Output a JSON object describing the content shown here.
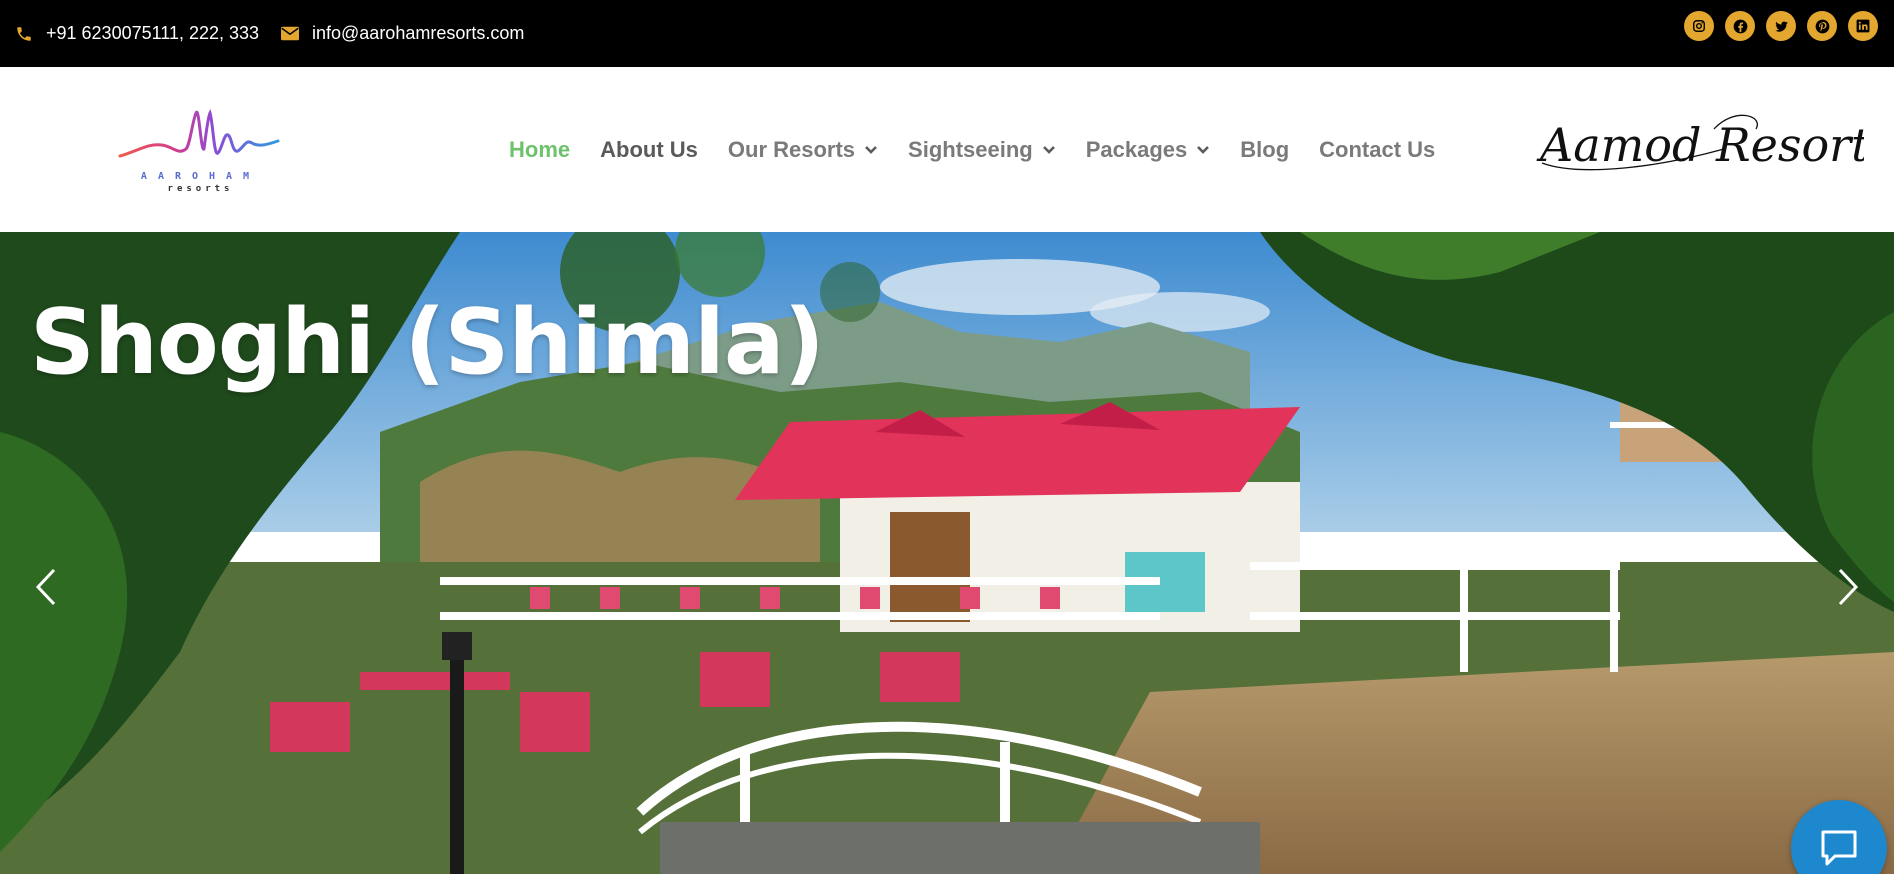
{
  "topbar": {
    "phone": "+91 6230075111, 222, 333",
    "email": "info@aarohamresorts.com",
    "socials": [
      "instagram-icon",
      "facebook-icon",
      "twitter-icon",
      "pinterest-icon",
      "linkedin-icon"
    ]
  },
  "header": {
    "logo": {
      "letters": "AAROHAM",
      "sub": "resorts"
    },
    "nav": [
      {
        "label": "Home",
        "has_dropdown": false,
        "active": true
      },
      {
        "label": "About Us",
        "has_dropdown": false
      },
      {
        "label": "Our Resorts",
        "has_dropdown": true
      },
      {
        "label": "Sightseeing",
        "has_dropdown": true
      },
      {
        "label": "Packages",
        "has_dropdown": true
      },
      {
        "label": "Blog",
        "has_dropdown": false
      },
      {
        "label": "Contact Us",
        "has_dropdown": false
      }
    ],
    "brand_right": "Aamod Resorts"
  },
  "hero": {
    "title": "Shoghi (Shimla)"
  },
  "colors": {
    "topbar_bg": "#000000",
    "accent_gold": "#e3a72f",
    "nav_active": "#6ec26a",
    "chat_blue": "#1e88cf",
    "roof_red": "#e2335a"
  }
}
